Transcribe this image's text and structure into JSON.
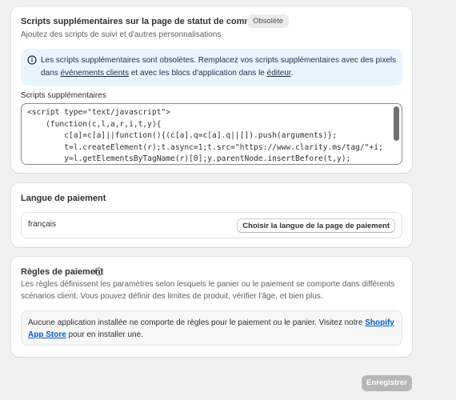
{
  "scripts_card": {
    "title": "Scripts supplémentaires sur la page de statut de commande",
    "badge": "Obsolète",
    "subtitle": "Ajoutez des scripts de suivi et d'autres personnalisations",
    "banner": {
      "icon": "info-icon",
      "text_before": "Les scripts supplémentaires sont obsolètes. Remplacez vos scripts supplémentaires avec des pixels dans ",
      "link1": "événements clients",
      "text_middle": " et avec les blocs d'application dans le ",
      "link2": "éditeur",
      "text_after": "."
    },
    "field_label": "Scripts supplémentaires",
    "code_lines": [
      "<script type=\"text/javascript\">",
      "    (function(c,l,a,r,i,t,y){",
      "        c[a]=c[a]||function(){(c[a].q=c[a].q||[]).push(arguments)};",
      "        t=l.createElement(r);t.async=1;t.src=\"https://www.clarity.ms/tag/\"+i;",
      "        y=l.getElementsByTagName(r)[0];y.parentNode.insertBefore(t,y);"
    ]
  },
  "language_card": {
    "title": "Langue de paiement",
    "value": "français",
    "button": "Choisir la langue de la page de paiement"
  },
  "rules_card": {
    "title": "Règles de paiement",
    "title_icon": "info-icon",
    "description": "Les règles définissent les paramètres selon lesquels le panier ou le paiement se comporte dans différents scénarios client. Vous pouvez définir des limites de produit, vérifier l'âge, et bien plus.",
    "empty_text_before": "Aucune application installée ne comporte de règles pour le paiement ou le panier. Visitez notre ",
    "empty_link": "Shopify App Store",
    "empty_text_after": " pour en installer une."
  },
  "save_button": "Enregistrer",
  "colors": {
    "page_bg": "#f1f1f1",
    "banner_bg": "#eaf4ff",
    "link": "#005bd3",
    "disabled_button": "#b7b7b7"
  }
}
